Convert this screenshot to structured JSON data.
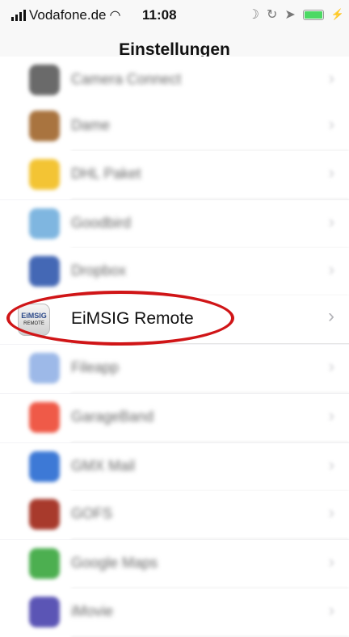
{
  "status_bar": {
    "carrier": "Vodafone.de",
    "time": "11:08",
    "icons": [
      "signal-icon",
      "wifi-icon",
      "moon-icon",
      "orientation-lock-icon",
      "location-icon",
      "battery-icon",
      "charging-icon"
    ]
  },
  "nav": {
    "title": "Einstellungen"
  },
  "rows": [
    {
      "label": "Camera Connect",
      "icon": "camera-connect-icon",
      "color": "#6a6a6a"
    },
    {
      "label": "Dame",
      "icon": "dame-icon",
      "color": "#a9743f"
    },
    {
      "label": "DHL Paket",
      "icon": "dhl-icon",
      "color": "#f3c434"
    },
    {
      "label": "Goodbird",
      "icon": "goodbird-icon",
      "color": "#7fb6e0"
    },
    {
      "label": "Dropbox",
      "icon": "dropbox-icon",
      "color": "#4468b5"
    },
    {
      "label": "EiMSIG Remote",
      "icon": "eimsig-remote-icon",
      "color": "#d6d6d6",
      "icon_text_1": "EiMSIG",
      "icon_text_2": "REMOTE"
    },
    {
      "label": "Fileapp",
      "icon": "fileapp-icon",
      "color": "#9db9e8"
    },
    {
      "label": "GarageBand",
      "icon": "garageband-icon",
      "color": "#ef5a48"
    },
    {
      "label": "GMX Mail",
      "icon": "gmx-mail-icon",
      "color": "#3d79d6"
    },
    {
      "label": "GOFS",
      "icon": "gofs-icon",
      "color": "#a83a2c"
    },
    {
      "label": "Google Maps",
      "icon": "google-maps-icon",
      "color": "#4caf50"
    },
    {
      "label": "iMovie",
      "icon": "imovie-icon",
      "color": "#5b55b5"
    }
  ],
  "highlight_color": "#d01517"
}
